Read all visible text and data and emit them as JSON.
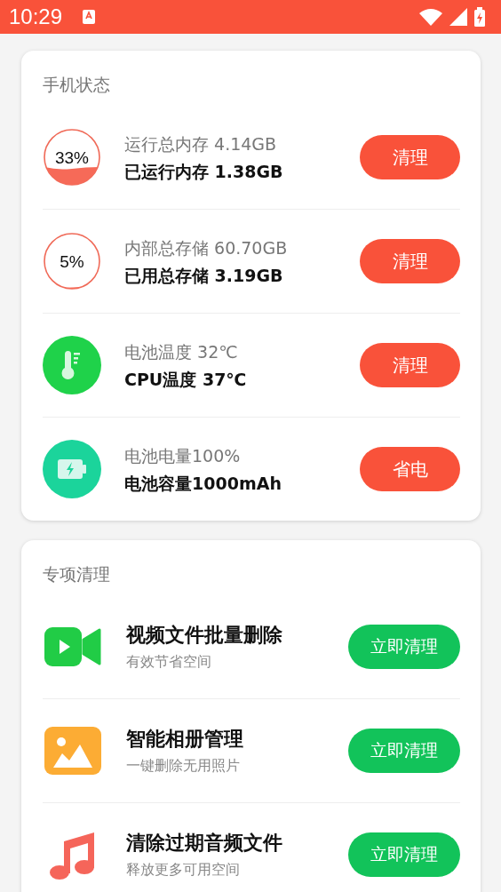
{
  "status_bar": {
    "time": "10:29"
  },
  "phone_status": {
    "title": "手机状态",
    "items": [
      {
        "kind": "gauge",
        "level": 0.33,
        "reading": "33%",
        "line1": "运行总内存 4.14GB",
        "line2": "已运行内存 1.38GB",
        "button": "清理"
      },
      {
        "kind": "gauge",
        "level": 0.05,
        "reading": "5%",
        "line1": "内部总存储 60.70GB",
        "line2": "已用总存储 3.19GB",
        "button": "清理"
      },
      {
        "kind": "thermometer",
        "line1": "电池温度 32℃",
        "line2": "CPU温度 37℃",
        "button": "清理"
      },
      {
        "kind": "battery",
        "line1": "电池电量100%",
        "line2": "电池容量1000mAh",
        "button": "省电"
      }
    ]
  },
  "special_clean": {
    "title": "专项清理",
    "items": [
      {
        "kind": "video",
        "title": "视频文件批量删除",
        "subtitle": "有效节省空间",
        "button": "立即清理"
      },
      {
        "kind": "photo",
        "title": "智能相册管理",
        "subtitle": "一键删除无用照片",
        "button": "立即清理"
      },
      {
        "kind": "music",
        "title": "清除过期音频文件",
        "subtitle": "释放更多可用空间",
        "button": "立即清理"
      }
    ]
  }
}
